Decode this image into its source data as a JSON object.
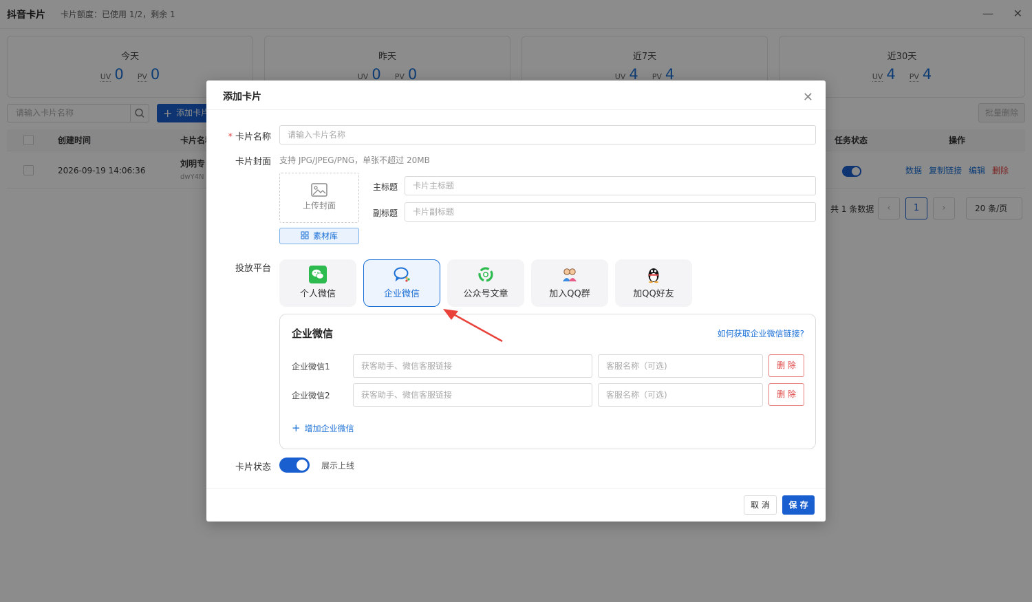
{
  "app": {
    "title": "抖音卡片",
    "quota": "卡片额度：已使用 1/2，剩余 1",
    "min_glyph": "—",
    "close_glyph": "✕"
  },
  "stats": [
    {
      "period": "今天",
      "uv_label": "UV",
      "uv": "0",
      "pv_label": "PV",
      "pv": "0"
    },
    {
      "period": "昨天",
      "uv_label": "UV",
      "uv": "0",
      "pv_label": "PV",
      "pv": "0"
    },
    {
      "period": "近7天",
      "uv_label": "UV",
      "uv": "4",
      "pv_label": "PV",
      "pv": "4"
    },
    {
      "period": "近30天",
      "uv_label": "UV",
      "uv": "4",
      "pv_label": "PV",
      "pv": "4"
    }
  ],
  "toolbar": {
    "search_placeholder": "请输入卡片名称",
    "add_label": "添加卡片",
    "batch_delete": "批量删除"
  },
  "table": {
    "headers": {
      "created": "创建时间",
      "name": "卡片名称",
      "status": "任务状态",
      "actions": "操作"
    },
    "rows": [
      {
        "created": "2026-09-19 14:06:36",
        "name": "刘明专",
        "sub": "dwY4N",
        "actions": {
          "data": "数据",
          "copy": "复制链接",
          "edit": "编辑",
          "delete": "删除"
        }
      }
    ]
  },
  "pager": {
    "total": "共 1 条数据",
    "prev": "‹",
    "current": "1",
    "next": "›",
    "page_size": "20 条/页"
  },
  "modal": {
    "title": "添加卡片",
    "close_glyph": "✕",
    "name_label": "卡片名称",
    "name_required_mark": "*",
    "name_placeholder": "请输入卡片名称",
    "cover_label": "卡片封面",
    "cover_hint": "支持 JPG/JPEG/PNG，单张不超过 20MB",
    "upload_label": "上传封面",
    "library_label": "素材库",
    "main_title_label": "主标题",
    "main_title_placeholder": "卡片主标题",
    "sub_title_label": "副标题",
    "sub_title_placeholder": "卡片副标题",
    "platform_label": "投放平台",
    "platforms": [
      {
        "label": "个人微信",
        "icon": "wechat-icon",
        "active": false
      },
      {
        "label": "企业微信",
        "icon": "wecom-icon",
        "active": true
      },
      {
        "label": "公众号文章",
        "icon": "official-account-icon",
        "active": false
      },
      {
        "label": "加入QQ群",
        "icon": "qq-group-icon",
        "active": false
      },
      {
        "label": "加QQ好友",
        "icon": "qq-penguin-icon",
        "active": false
      }
    ],
    "panel": {
      "title": "企业微信",
      "help_link": "如何获取企业微信链接?",
      "entries": [
        {
          "label": "企业微信1",
          "link_placeholder": "获客助手、微信客服链接",
          "name_placeholder": "客服名称（可选)",
          "delete": "删 除"
        },
        {
          "label": "企业微信2",
          "link_placeholder": "获客助手、微信客服链接",
          "name_placeholder": "客服名称（可选)",
          "delete": "删 除"
        }
      ],
      "add_label": "增加企业微信"
    },
    "status_label": "卡片状态",
    "status_text": "展示上线",
    "status_on": true,
    "cancel": "取 消",
    "save": "保 存"
  },
  "colors": {
    "primary": "#1a5fd0",
    "link": "#1a6fd6",
    "danger": "#e04545",
    "annotation_arrow": "#e8423a"
  }
}
